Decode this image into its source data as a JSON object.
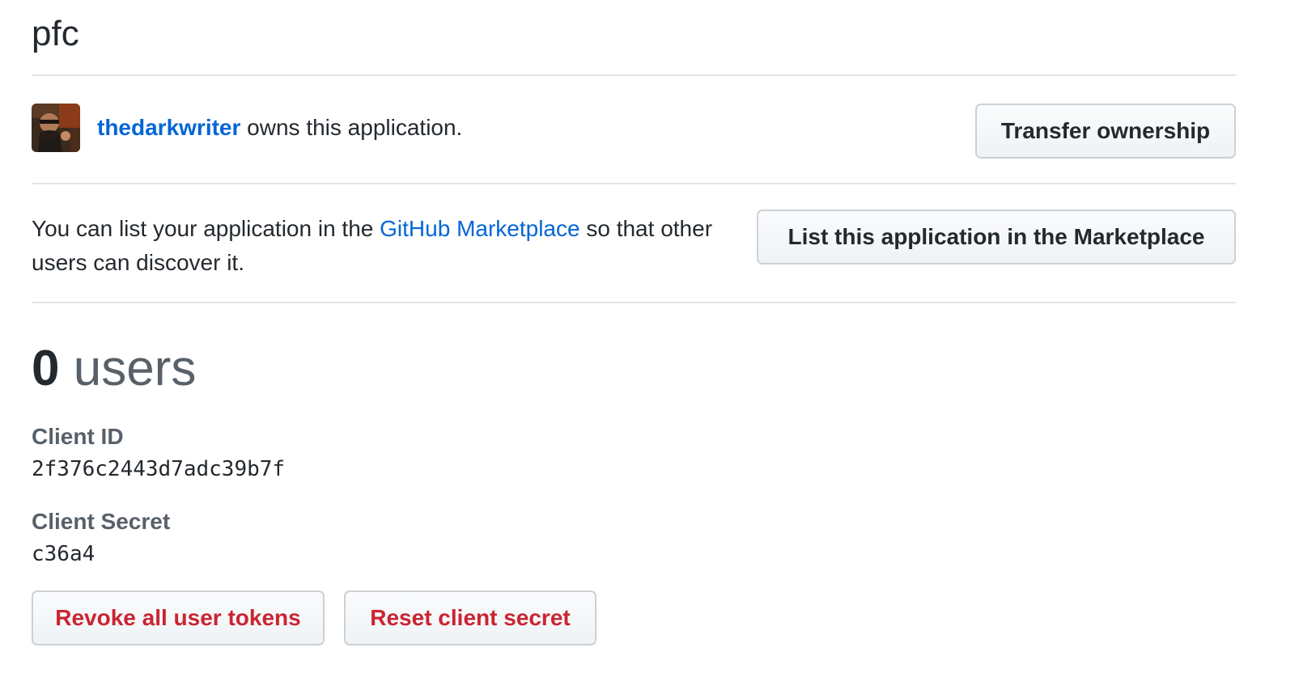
{
  "app": {
    "title": "pfc"
  },
  "owner": {
    "username": "thedarkwriter",
    "suffix_text": " owns this application.",
    "transfer_button_label": "Transfer ownership",
    "avatar_icon": "user-avatar"
  },
  "marketplace": {
    "text_before": "You can list your application in the ",
    "link_text": "GitHub Marketplace",
    "text_after": " so that other users can discover it.",
    "button_label": "List this application in the Marketplace"
  },
  "users": {
    "count": "0",
    "label": "users"
  },
  "credentials": {
    "client_id_label": "Client ID",
    "client_id_value": "2f376c2443d7adc39b7f",
    "client_secret_label": "Client Secret",
    "client_secret_value": "c36a4"
  },
  "actions": {
    "revoke_label": "Revoke all user tokens",
    "reset_label": "Reset client secret"
  },
  "colors": {
    "link": "#0366d6",
    "danger": "#cb2431",
    "text": "#24292e",
    "muted": "#586069",
    "divider": "#e1e4e8"
  }
}
